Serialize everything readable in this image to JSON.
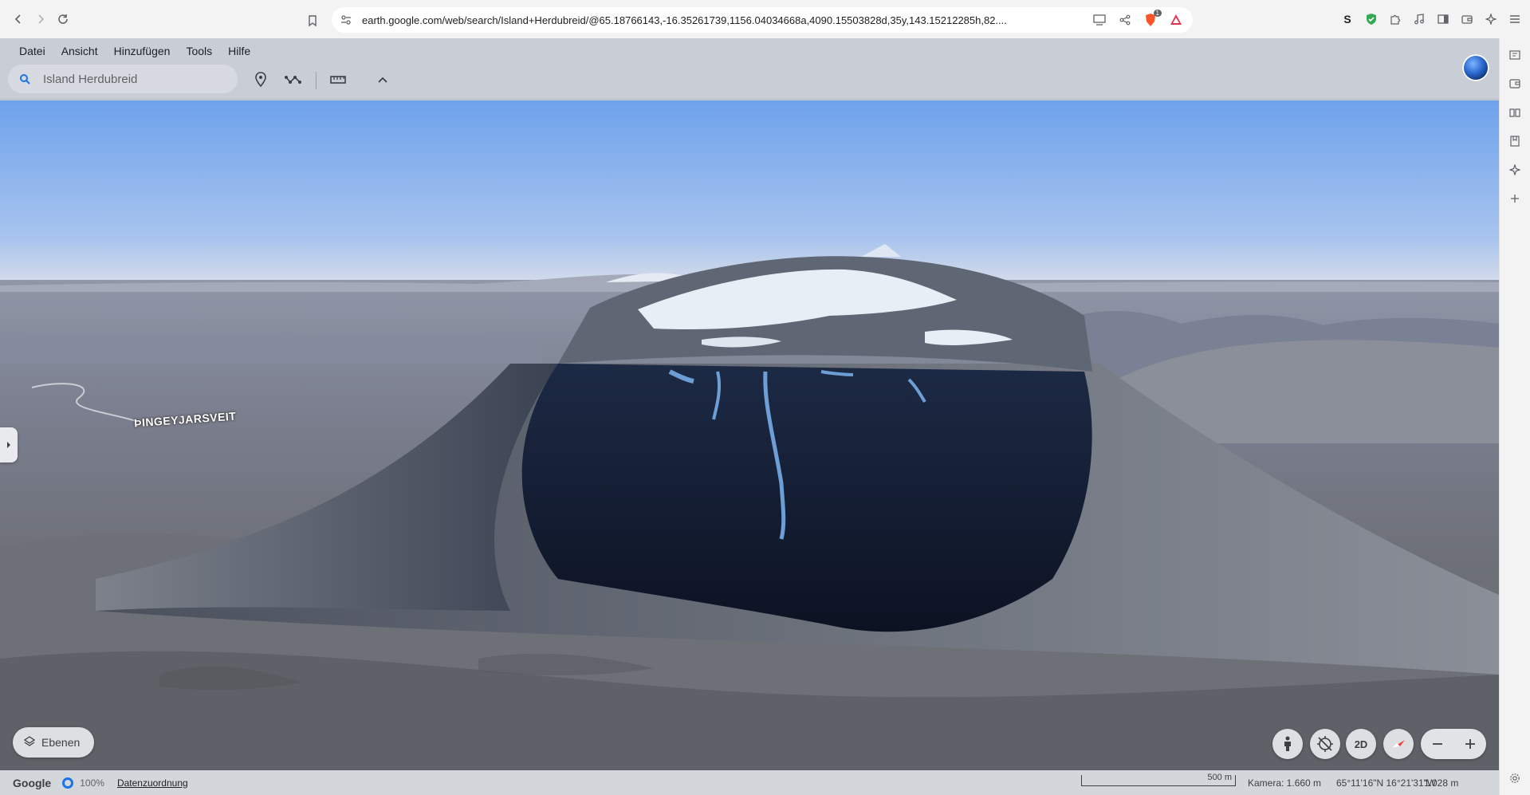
{
  "browser": {
    "url": "earth.google.com/web/search/Island+Herdubreid/@65.18766143,-16.35261739,1156.04034668a,4090.15503828d,35y,143.15212285h,82....",
    "extension_badge": "1"
  },
  "app": {
    "menu": [
      "Datei",
      "Ansicht",
      "Hinzufügen",
      "Tools",
      "Hilfe"
    ],
    "search": {
      "value": "Island Herdubreid"
    },
    "map_label": "ÞINGEYJARSVEIT",
    "layers_label": "Ebenen",
    "view_mode_label": "2D",
    "status": {
      "brand": "Google",
      "load_percent": "100%",
      "attribution": "Datenzuordnung",
      "scale": "500 m",
      "camera": "Kamera: 1.660 m",
      "coords": "65°11'16\"N 16°21'31\"W",
      "elevation": "1.028 m"
    }
  },
  "colors": {
    "accent": "#1a73e8",
    "sky_top": "#6fa3ec",
    "sky_horizon": "#c7d6ee",
    "terrain": "#6a6f78",
    "snow": "#e8eef5"
  }
}
